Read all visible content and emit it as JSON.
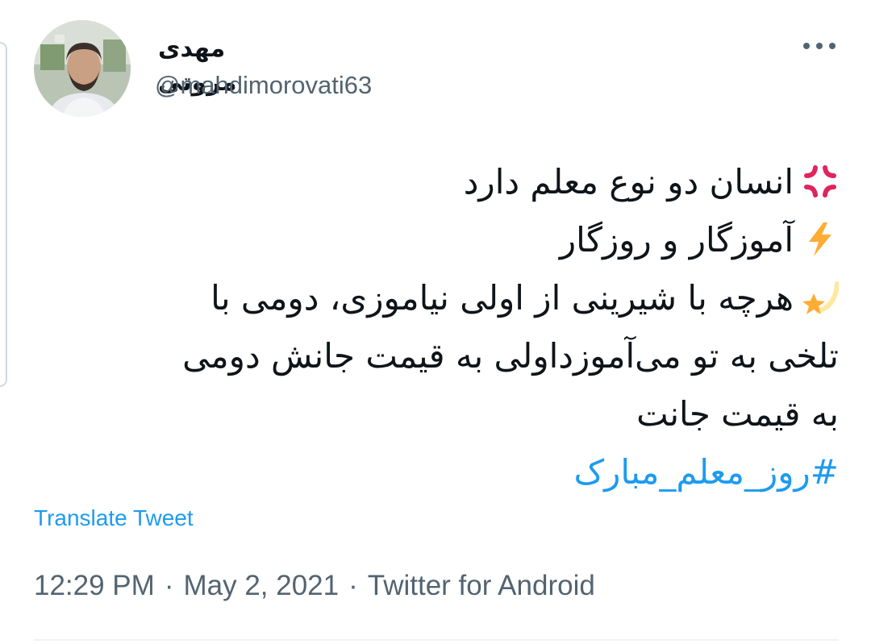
{
  "author": {
    "display_name": "مهدی مروتی",
    "handle": "@mahdimorovati63"
  },
  "tweet": {
    "lines": [
      {
        "emoji": "anger-symbol-icon",
        "text": "انسان دو نوع معلم دارد"
      },
      {
        "emoji": "high-voltage-icon",
        "text": "آموزگار و روزگار"
      },
      {
        "emoji": "shooting-star-icon",
        "text": "هرچه با شیرینی از اولی نیاموزی، دومی با"
      },
      {
        "emoji": "",
        "text": "تلخی به تو می‌آموزداولی به قیمت جانش دومی"
      },
      {
        "emoji": "",
        "text": "به قیمت جانت"
      }
    ],
    "hashtag": "#روز_معلم_مبارک"
  },
  "translate_label": "Translate Tweet",
  "meta": {
    "time": "12:29 PM",
    "date": "May 2, 2021",
    "source": "Twitter for Android",
    "separator": "·"
  },
  "colors": {
    "link": "#1d9bf0",
    "text": "#0f1419",
    "secondary": "#536471"
  }
}
